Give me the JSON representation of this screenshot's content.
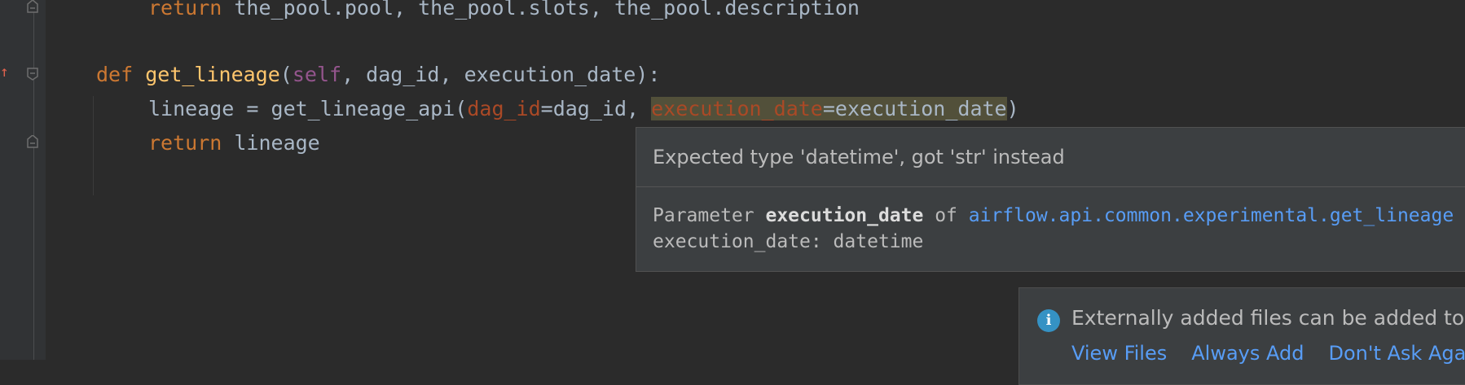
{
  "code": {
    "line1": {
      "kw": "return",
      "rest": " the_pool.pool, the_pool.slots, the_pool.description"
    },
    "line2": {
      "kw": "def",
      "fn": "get_lineage",
      "open": "(",
      "self": "self",
      "rest": ", dag_id, execution_date):"
    },
    "line3": {
      "prefix": "lineage = get_lineage_api(",
      "param1": "dag_id",
      "mid": "=dag_id, ",
      "param2": "execution_date",
      "tail": "=execution_date",
      "close": ")"
    },
    "line4": {
      "kw": "return",
      "rest": " lineage"
    }
  },
  "tooltip": {
    "title": "Expected type 'datetime', got 'str' instead",
    "param_prefix": "Parameter ",
    "param_name": "execution_date",
    "param_of": " of ",
    "param_link": "airflow.api.common.experimental.get_lineage",
    "signature": "execution_date: datetime"
  },
  "notification": {
    "icon": "info-icon",
    "message": "Externally added files can be added to Git",
    "actions": [
      "View Files",
      "Always Add",
      "Don't Ask Again"
    ]
  },
  "colors": {
    "editor_bg": "#2b2b2b",
    "keyword": "#cc7832",
    "function": "#ffc66d",
    "self": "#94558d",
    "param": "#aa4926",
    "link": "#589df6"
  }
}
